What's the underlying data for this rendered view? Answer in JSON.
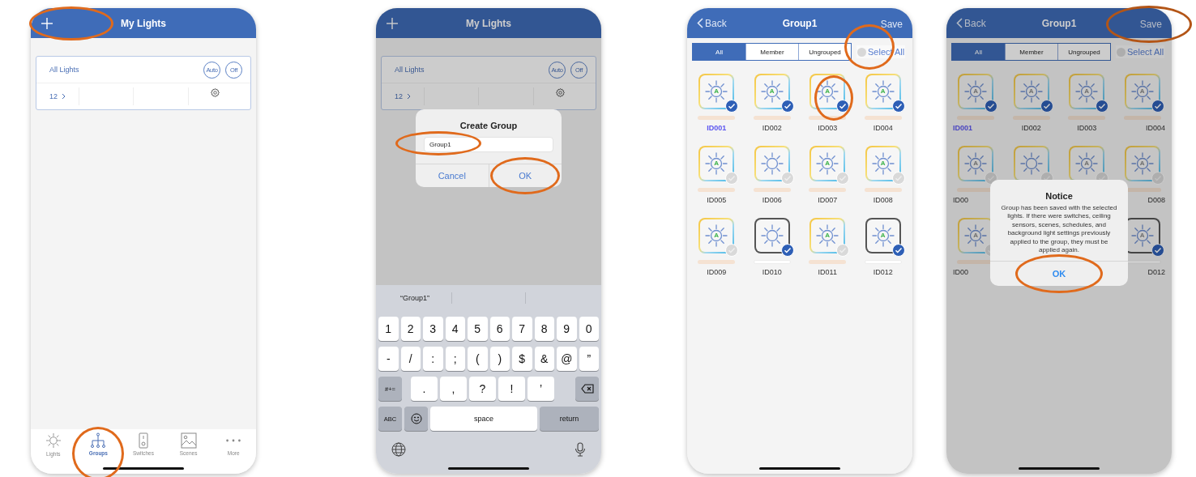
{
  "screens": [
    {
      "kind": "groups",
      "dimmed": false,
      "header": {
        "left": {
          "kind": "add",
          "highlighted": true
        },
        "title": "My Lights"
      },
      "group_card": {
        "name": "All Lights",
        "buttons": [
          "Auto",
          "Off"
        ],
        "count": "12"
      },
      "tabs": [
        {
          "kind": "lights",
          "label": "Lights",
          "selected": false,
          "highlighted": false
        },
        {
          "kind": "groups",
          "label": "Groups",
          "selected": true,
          "highlighted": true
        },
        {
          "kind": "switches",
          "label": "Switches",
          "selected": false,
          "highlighted": false
        },
        {
          "kind": "scenes",
          "label": "Scenes",
          "selected": false,
          "highlighted": false
        },
        {
          "kind": "more",
          "label": "More",
          "selected": false,
          "highlighted": false
        }
      ]
    },
    {
      "kind": "create",
      "dimmed": true,
      "header": {
        "left": {
          "kind": "add",
          "highlighted": false
        },
        "title": "My Lights"
      },
      "group_card": {
        "name": "All Lights",
        "buttons": [
          "Auto",
          "Off"
        ],
        "count": "12"
      },
      "dialog": {
        "kind": "input",
        "title": "Create Group",
        "value": "Group1",
        "field_highlighted": true,
        "buttons": [
          {
            "label": "Cancel",
            "highlighted": false
          },
          {
            "label": "OK",
            "highlighted": true
          }
        ]
      },
      "keyboard": {
        "suggestions": [
          "“Group1”"
        ],
        "rows": [
          {
            "keys": [
              {
                "kind": "char",
                "label": "1"
              },
              {
                "kind": "char",
                "label": "2"
              },
              {
                "kind": "char",
                "label": "3"
              },
              {
                "kind": "char",
                "label": "4"
              },
              {
                "kind": "char",
                "label": "5"
              },
              {
                "kind": "char",
                "label": "6"
              },
              {
                "kind": "char",
                "label": "7"
              },
              {
                "kind": "char",
                "label": "8"
              },
              {
                "kind": "char",
                "label": "9"
              },
              {
                "kind": "char",
                "label": "0"
              }
            ]
          },
          {
            "keys": [
              {
                "kind": "char",
                "label": "-"
              },
              {
                "kind": "char",
                "label": "/"
              },
              {
                "kind": "char",
                "label": ":"
              },
              {
                "kind": "char",
                "label": ";"
              },
              {
                "kind": "char",
                "label": "("
              },
              {
                "kind": "char",
                "label": ")"
              },
              {
                "kind": "char",
                "label": "$"
              },
              {
                "kind": "char",
                "label": "&"
              },
              {
                "kind": "char",
                "label": "@"
              },
              {
                "kind": "char",
                "label": "”"
              }
            ]
          },
          {
            "keys": [
              {
                "kind": "mod",
                "label": "#+="
              },
              {
                "kind": "wide",
                "label": "."
              },
              {
                "kind": "wide",
                "label": ","
              },
              {
                "kind": "wide",
                "label": "?"
              },
              {
                "kind": "wide",
                "label": "!"
              },
              {
                "kind": "wide",
                "label": "’"
              },
              {
                "kind": "backspace"
              }
            ]
          },
          {
            "keys": [
              {
                "kind": "mod",
                "label": "ABC"
              },
              {
                "kind": "emoji"
              },
              {
                "kind": "space",
                "label": "space"
              },
              {
                "kind": "return",
                "label": "return"
              }
            ]
          }
        ]
      }
    },
    {
      "kind": "members",
      "dimmed": false,
      "header": {
        "left": {
          "kind": "back",
          "label": "Back"
        },
        "title": "Group1",
        "right": {
          "label": "Save",
          "highlighted": false
        }
      },
      "segments": [
        {
          "label": "All",
          "selected": true
        },
        {
          "label": "Member",
          "selected": false
        },
        {
          "label": "Ungrouped",
          "selected": false
        }
      ],
      "select_all": {
        "label": "Select All",
        "checked": false,
        "highlighted": true
      },
      "lights": [
        {
          "label": "ID001",
          "kind": "tunable",
          "mode": "A",
          "checked": true,
          "selected": true,
          "highlighted": false
        },
        {
          "label": "ID002",
          "kind": "tunable",
          "mode": "A",
          "checked": true,
          "selected": false,
          "highlighted": false
        },
        {
          "label": "ID003",
          "kind": "tunable",
          "mode": "A",
          "checked": true,
          "selected": false,
          "highlighted": true
        },
        {
          "label": "ID004",
          "kind": "tunable",
          "mode": "A",
          "checked": true,
          "selected": false,
          "highlighted": false
        },
        {
          "label": "ID005",
          "kind": "tunable",
          "mode": "A",
          "checked": false,
          "selected": false,
          "highlighted": false
        },
        {
          "label": "ID006",
          "kind": "tunable",
          "checked": false,
          "selected": false,
          "highlighted": false
        },
        {
          "label": "ID007",
          "kind": "tunable",
          "mode": "A",
          "checked": false,
          "selected": false,
          "highlighted": false
        },
        {
          "label": "ID008",
          "kind": "tunable",
          "mode": "A",
          "checked": false,
          "selected": false,
          "highlighted": false
        },
        {
          "label": "ID009",
          "kind": "tunable",
          "mode": "A",
          "checked": false,
          "selected": false,
          "highlighted": false
        },
        {
          "label": "ID010",
          "kind": "plain",
          "checked": true,
          "selected": false,
          "highlighted": false
        },
        {
          "label": "ID011",
          "kind": "tunable",
          "mode": "A",
          "checked": false,
          "selected": false,
          "highlighted": false
        },
        {
          "label": "ID012",
          "kind": "plain",
          "mode": "A",
          "checked": true,
          "selected": false,
          "highlighted": false
        }
      ]
    },
    {
      "kind": "members",
      "dimmed": true,
      "header": {
        "left": {
          "kind": "back",
          "label": "Back"
        },
        "title": "Group1",
        "right": {
          "label": "Save",
          "highlighted": true
        }
      },
      "segments": [
        {
          "label": "All",
          "selected": true
        },
        {
          "label": "Member",
          "selected": false
        },
        {
          "label": "Ungrouped",
          "selected": false
        }
      ],
      "select_all": {
        "label": "Select All",
        "checked": false,
        "highlighted": false
      },
      "lights": [
        {
          "label": "ID001",
          "kind": "tunable",
          "mode": "A",
          "checked": true,
          "selected": true,
          "highlighted": false
        },
        {
          "label": "ID002",
          "kind": "tunable",
          "mode": "A",
          "checked": true,
          "selected": false,
          "highlighted": false
        },
        {
          "label": "ID003",
          "kind": "tunable",
          "mode": "A",
          "checked": true,
          "selected": false,
          "highlighted": false
        },
        {
          "label": "ID004",
          "kind": "tunable",
          "mode": "A",
          "checked": true,
          "selected": false,
          "highlighted": false
        },
        {
          "label": "ID00",
          "kind": "tunable",
          "mode": "A",
          "checked": false,
          "selected": false,
          "highlighted": false
        },
        {
          "kind": "tunable",
          "checked": false,
          "highlighted": false
        },
        {
          "kind": "tunable",
          "mode": "A",
          "checked": false,
          "highlighted": false
        },
        {
          "label": "D008",
          "kind": "tunable",
          "mode": "A",
          "checked": false,
          "selected": false,
          "highlighted": false
        },
        {
          "label": "ID00",
          "kind": "tunable",
          "mode": "A",
          "checked": false,
          "selected": false,
          "highlighted": false
        },
        {
          "hidden": true
        },
        {
          "hidden": true
        },
        {
          "label": "D012",
          "kind": "plain",
          "mode": "A",
          "checked": true,
          "selected": false,
          "highlighted": false
        }
      ],
      "dialog": {
        "kind": "notice",
        "title": "Notice",
        "message": "Group has been saved with the selected lights. If there were switches, ceiling sensors, scenes, schedules, and background light settings previously applied to the group, they must be applied again.",
        "buttons": [
          {
            "label": "OK",
            "highlighted": true
          }
        ]
      }
    }
  ]
}
